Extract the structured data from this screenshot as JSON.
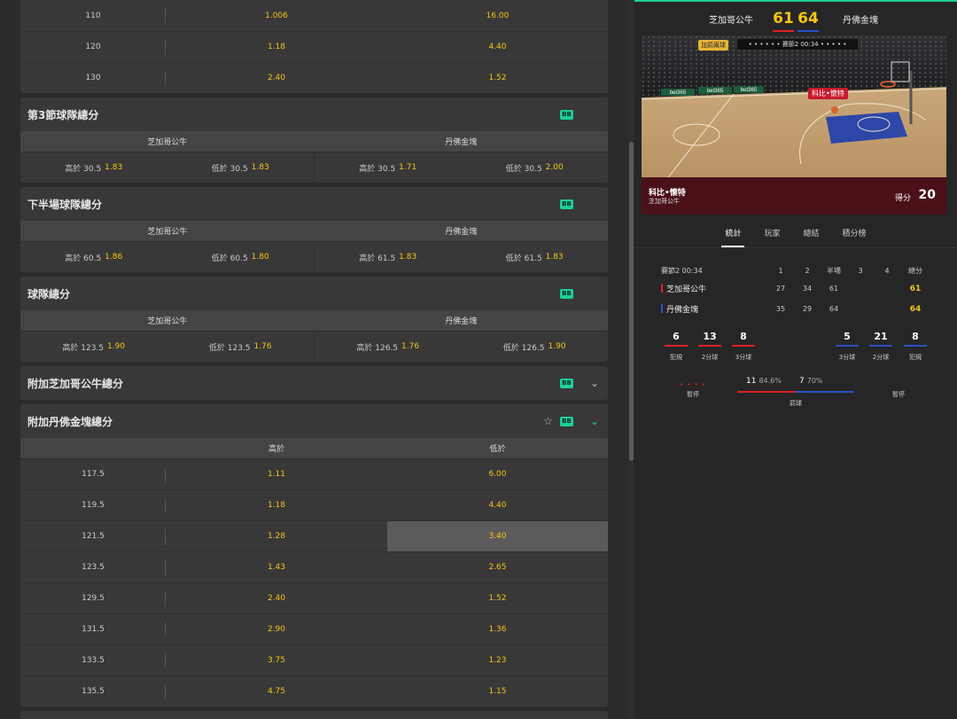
{
  "top_lines": [
    {
      "line": "110",
      "over": "1.006",
      "under": "16.00"
    },
    {
      "line": "120",
      "over": "1.18",
      "under": "4.40"
    },
    {
      "line": "130",
      "over": "2.40",
      "under": "1.52"
    }
  ],
  "q3_team_total": {
    "title": "第3節球隊總分",
    "badge": "BB",
    "team_home": "芝加哥公牛",
    "team_away": "丹佛金塊",
    "cells": [
      {
        "label": "高於 30.5",
        "odd": "1.83"
      },
      {
        "label": "低於 30.5",
        "odd": "1.83"
      },
      {
        "label": "高於 30.5",
        "odd": "1.71"
      },
      {
        "label": "低於 30.5",
        "odd": "2.00"
      }
    ]
  },
  "second_half_total": {
    "title": "下半場球隊總分",
    "badge": "BB",
    "team_home": "芝加哥公牛",
    "team_away": "丹佛金塊",
    "cells": [
      {
        "label": "高於 60.5",
        "odd": "1.86"
      },
      {
        "label": "低於 60.5",
        "odd": "1.80"
      },
      {
        "label": "高於 61.5",
        "odd": "1.83"
      },
      {
        "label": "低於 61.5",
        "odd": "1.83"
      }
    ]
  },
  "team_total": {
    "title": "球隊總分",
    "badge": "BB",
    "team_home": "芝加哥公牛",
    "team_away": "丹佛金塊",
    "cells": [
      {
        "label": "高於 123.5",
        "odd": "1.90"
      },
      {
        "label": "低於 123.5",
        "odd": "1.76"
      },
      {
        "label": "高於 126.5",
        "odd": "1.76"
      },
      {
        "label": "低於 126.5",
        "odd": "1.90"
      }
    ]
  },
  "extra_bulls": {
    "title": "附加芝加哥公牛總分",
    "badge": "BB",
    "chevron": "⌄"
  },
  "extra_nuggets": {
    "title": "附加丹佛金塊總分",
    "badge": "BB",
    "star": "☆",
    "chevron": "⌄",
    "col_over": "高於",
    "col_under": "低於",
    "rows": [
      {
        "line": "117.5",
        "over": "1.11",
        "under": "6.00"
      },
      {
        "line": "119.5",
        "over": "1.18",
        "under": "4.40"
      },
      {
        "line": "121.5",
        "over": "1.28",
        "under": "3.40"
      },
      {
        "line": "123.5",
        "over": "1.43",
        "under": "2.65"
      },
      {
        "line": "129.5",
        "over": "2.40",
        "under": "1.52"
      },
      {
        "line": "131.5",
        "over": "2.90",
        "under": "1.36"
      },
      {
        "line": "133.5",
        "over": "3.75",
        "under": "1.23"
      },
      {
        "line": "135.5",
        "over": "4.75",
        "under": "1.15"
      }
    ]
  },
  "scoreboard": {
    "home": "芝加哥公牛",
    "away": "丹佛金塊",
    "home_score": "61",
    "away_score": "64"
  },
  "court": {
    "badge": "加罰兩球",
    "clock": "• • • • • •  賽節2 00:34  • • • • •",
    "player_tag": "科比•懷特",
    "player_name": "科比•懷特",
    "player_team": "芝加哥公牛",
    "stat_label": "得分",
    "stat_value": "20",
    "ad": "bet365"
  },
  "tabs": [
    "統計",
    "玩家",
    "總結",
    "積分榜"
  ],
  "stats": {
    "period_label": "賽節2 00:34",
    "cols": [
      "1",
      "2",
      "半場",
      "3",
      "4",
      "總分"
    ],
    "home": {
      "name": "芝加哥公牛",
      "q": [
        "27",
        "34",
        "61",
        "",
        ""
      ],
      "total": "61"
    },
    "away": {
      "name": "丹佛金塊",
      "q": [
        "35",
        "29",
        "64",
        "",
        ""
      ],
      "total": "64"
    }
  },
  "team_stats": {
    "home": [
      {
        "v": "6",
        "label": "犯規"
      },
      {
        "v": "13",
        "label": "2分球"
      },
      {
        "v": "8",
        "label": "3分球"
      }
    ],
    "away": [
      {
        "v": "5",
        "label": "3分球"
      },
      {
        "v": "21",
        "label": "2分球"
      },
      {
        "v": "8",
        "label": "犯規"
      }
    ],
    "timeout_label": "暫停",
    "timeout_dots": "• • • •",
    "ft": {
      "home": "11",
      "home_pct": "84.6%",
      "away": "7",
      "away_pct": "70%",
      "label": "罰球"
    }
  },
  "colors": {
    "odd": "#f5c518",
    "accent": "#1fcf9a",
    "home": "#dd2222",
    "away": "#2a52c8"
  }
}
